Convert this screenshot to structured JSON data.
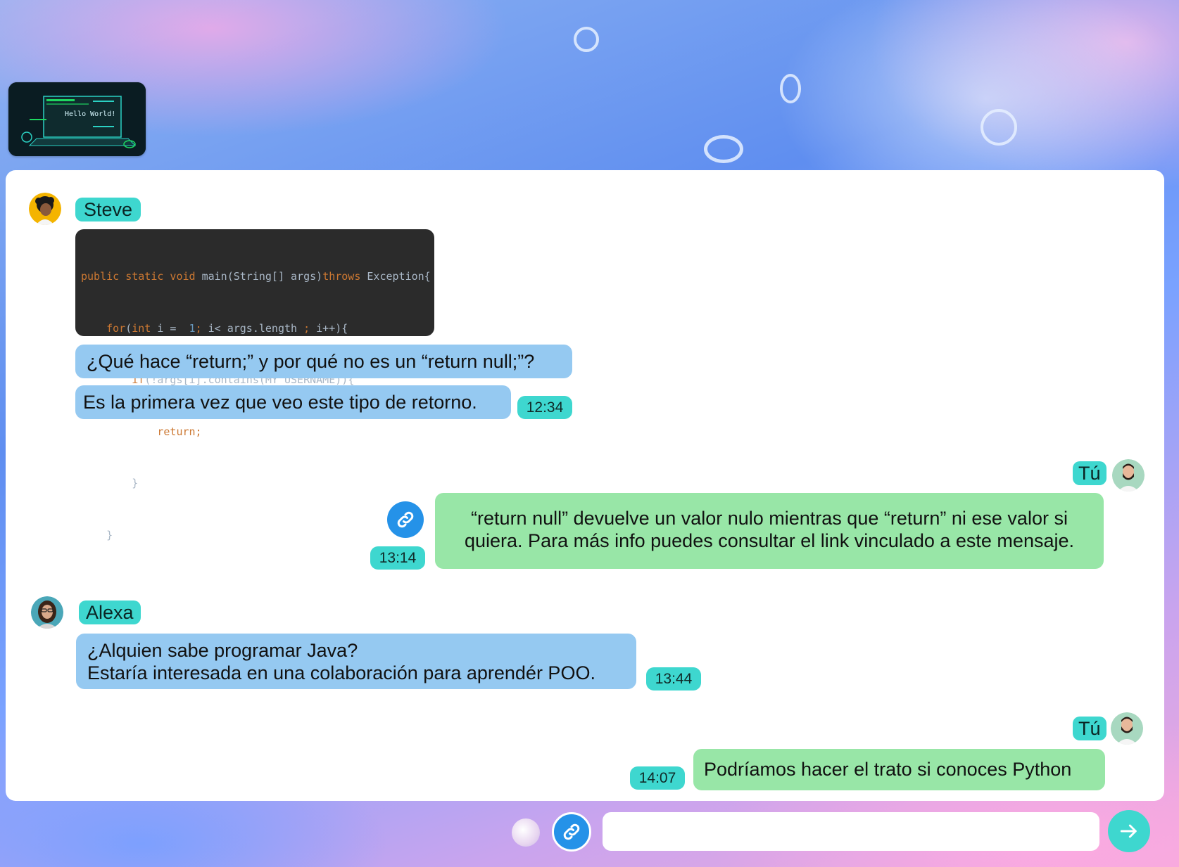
{
  "colors": {
    "name_tag": "#3ed7cf",
    "incoming_bubble": "#95c9f1",
    "outgoing_bubble": "#98e6a7",
    "link_button": "#2592e8",
    "send_button": "#3ed7cf",
    "code_background": "#2b2b2b"
  },
  "header": {
    "thumbnail_text": "Hello World!"
  },
  "messages": {
    "steve": {
      "name": "Steve",
      "code_lines": [
        "public static void main(String[] args)throws Exception{",
        "    for(int i =  1; i< args.length ; i++){",
        "        if(!args[i].contains(MY_USERNAME)){",
        "            return;",
        "        }",
        "    }"
      ],
      "text1": "¿Qué hace “return;” y por qué no es un “return null;”?",
      "text2": "Es la primera vez que veo este tipo de retorno.",
      "time": "12:34"
    },
    "me1": {
      "name": "Tú",
      "line1": "“return null” devuelve un valor nulo mientras que “return” ni ese valor si",
      "line2": "quiera. Para más info puedes consultar el link vinculado a este mensaje.",
      "time": "13:14",
      "link_icon": "link-icon"
    },
    "alexa": {
      "name": "Alexa",
      "line1": "¿Alquien sabe programar Java?",
      "line2": "Estaría interesada en una colaboración para aprendér POO.",
      "time": "13:44"
    },
    "me2": {
      "name": "Tú",
      "text": "Podríamos hacer el trato si conoces Python",
      "time": "14:07"
    }
  },
  "composer": {
    "input_value": "",
    "attach_icon": "link-icon",
    "send_icon": "arrow-right-icon"
  }
}
